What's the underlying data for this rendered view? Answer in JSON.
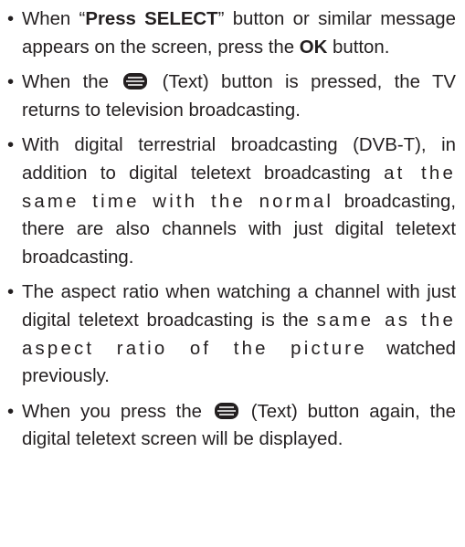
{
  "bullet_char": "•",
  "items": [
    {
      "t1": "When “",
      "b1": "Press SELECT",
      "t2": "” button or similar message appears on the screen, press the ",
      "b2": "OK",
      "t3": " button."
    },
    {
      "t1": "When the ",
      "icon": "text-button-icon",
      "t2": " (Text) button is pressed, the TV returns to television broadcasting."
    },
    {
      "t1": "With digital terrestrial broadcasting (DVB-T), in addition to digital teletext broadcasting",
      "t2": "at the same time with the normal",
      "t3": "broadcasting, there are also channels with just digital teletext broadcasting."
    },
    {
      "t1": "The aspect ratio when watching a channel with just digital teletext broadcasting is the",
      "t2": "same as the aspect ratio of the picture",
      "t3": "watched previously."
    },
    {
      "t1": "When you press the ",
      "icon": "text-button-icon",
      "t2": " (Text) button again, the digital teletext screen will be displayed."
    }
  ]
}
